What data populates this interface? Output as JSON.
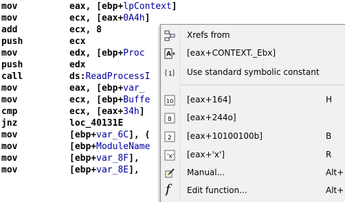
{
  "disassembly": [
    {
      "mnemonic": "mov",
      "operand": "eax, [ebp+",
      "highlight": "lpContext",
      "tail": "]"
    },
    {
      "mnemonic": "mov",
      "operand": "ecx, [eax+",
      "highlight": "0A4h",
      "tail": "]"
    },
    {
      "mnemonic": "add",
      "operand": "ecx, 8",
      "highlight": "",
      "tail": ""
    },
    {
      "mnemonic": "push",
      "operand": "ecx",
      "highlight": "",
      "tail": ""
    },
    {
      "mnemonic": "mov",
      "operand": "edx, [ebp+",
      "highlight": "Proc",
      "tail": ""
    },
    {
      "mnemonic": "push",
      "operand": "edx",
      "highlight": "",
      "tail": ""
    },
    {
      "mnemonic": "call",
      "operand": "ds:",
      "highlight": "ReadProcessI",
      "tail": ""
    },
    {
      "mnemonic": "mov",
      "operand": "eax, [ebp+",
      "highlight": "var_",
      "tail": ""
    },
    {
      "mnemonic": "mov",
      "operand": "ecx, [ebp+",
      "highlight": "Buffe",
      "tail": ""
    },
    {
      "mnemonic": "cmp",
      "operand": "ecx, [eax+",
      "highlight": "34h",
      "tail": "]"
    },
    {
      "mnemonic": "jnz",
      "operand": "loc_40131E",
      "highlight": "",
      "tail": ""
    },
    {
      "mnemonic": "mov",
      "operand": "[ebp+",
      "highlight": "var_6C",
      "tail": "], ("
    },
    {
      "mnemonic": "mov",
      "operand": "[ebp+",
      "highlight": "ModuleName",
      "tail": ""
    },
    {
      "mnemonic": "mov",
      "operand": "[ebp+",
      "highlight": "var_8F",
      "tail": "], "
    },
    {
      "mnemonic": "mov",
      "operand": "[ebp+",
      "highlight": "var_8E",
      "tail": "], "
    }
  ],
  "context_menu": {
    "items": [
      {
        "icon": "xrefs-icon",
        "label": "Xrefs from",
        "shortcut": ""
      },
      {
        "icon": "struct-offset-icon",
        "label": "[eax+CONTEXT._Ebx]",
        "shortcut": ""
      },
      {
        "icon": "symbolic-constant-icon",
        "label": "Use standard symbolic constant",
        "shortcut": ""
      },
      {
        "icon": "decimal-icon",
        "label": "[eax+164]",
        "shortcut": "H"
      },
      {
        "icon": "octal-icon",
        "label": "[eax+244o]",
        "shortcut": ""
      },
      {
        "icon": "binary-icon",
        "label": "[eax+10100100b]",
        "shortcut": "B"
      },
      {
        "icon": "char-icon",
        "label": "[eax+'x']",
        "shortcut": "R"
      },
      {
        "icon": "manual-icon",
        "label": "Manual...",
        "shortcut": "Alt+"
      },
      {
        "icon": "function-icon",
        "label": "Edit function...",
        "shortcut": "Alt+"
      }
    ]
  }
}
